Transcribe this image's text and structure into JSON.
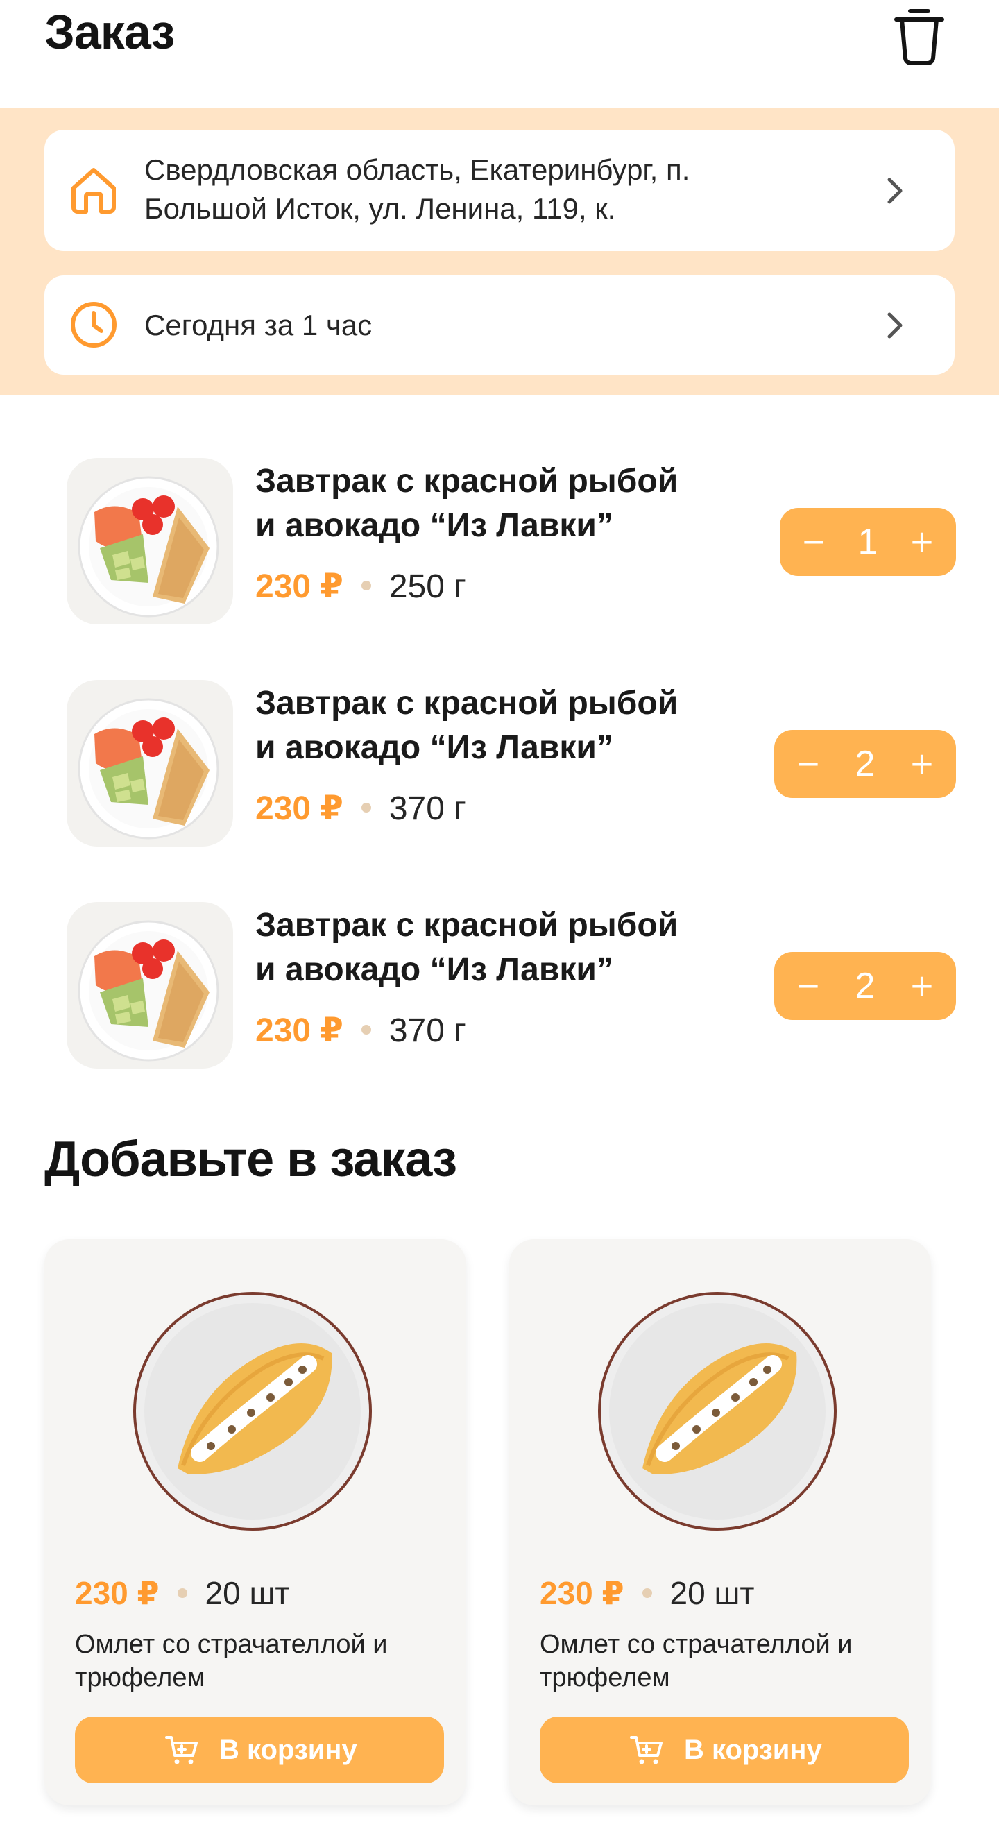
{
  "header": {
    "title": "Заказ"
  },
  "delivery": {
    "address_line1": "Свердловская область, Екатеринбург, п.",
    "address_line2": "Большой Исток, ул. Ленина, 119, к.",
    "time": "Сегодня за 1 час"
  },
  "order_items": [
    {
      "name_line1": "Завтрак с красной рыбой",
      "name_line2": "и авокадо “Из Лавки”",
      "price": "230 ₽",
      "weight": "250 г",
      "quantity": "1"
    },
    {
      "name_line1": "Завтрак с красной рыбой",
      "name_line2": "и авокадо “Из Лавки”",
      "price": "230 ₽",
      "weight": "370 г",
      "quantity": "2"
    },
    {
      "name_line1": "Завтрак с красной рыбой",
      "name_line2": "и авокадо “Из Лавки”",
      "price": "230 ₽",
      "weight": "370 г",
      "quantity": "2"
    }
  ],
  "stepper": {
    "minus": "−",
    "plus": "+"
  },
  "suggestions": {
    "title": "Добавьте в заказ",
    "items": [
      {
        "price": "230 ₽",
        "amount": "20 шт",
        "name_line1": "Омлет со страчателлой и",
        "name_line2": "трюфелем",
        "button_label": "В корзину"
      },
      {
        "price": "230 ₽",
        "amount": "20 шт",
        "name_line1": "Омлет со страчателлой и",
        "name_line2": "трюфелем",
        "button_label": "В корзину"
      }
    ]
  },
  "colors": {
    "accent": "#ffb351",
    "price": "#ff9a2f",
    "info_band": "#ffe4c6",
    "icon": "#ff9a2f"
  },
  "icons": [
    "trash-icon",
    "home-icon",
    "clock-icon",
    "chevron-right-icon",
    "minus-icon",
    "plus-icon",
    "cart-icon"
  ]
}
